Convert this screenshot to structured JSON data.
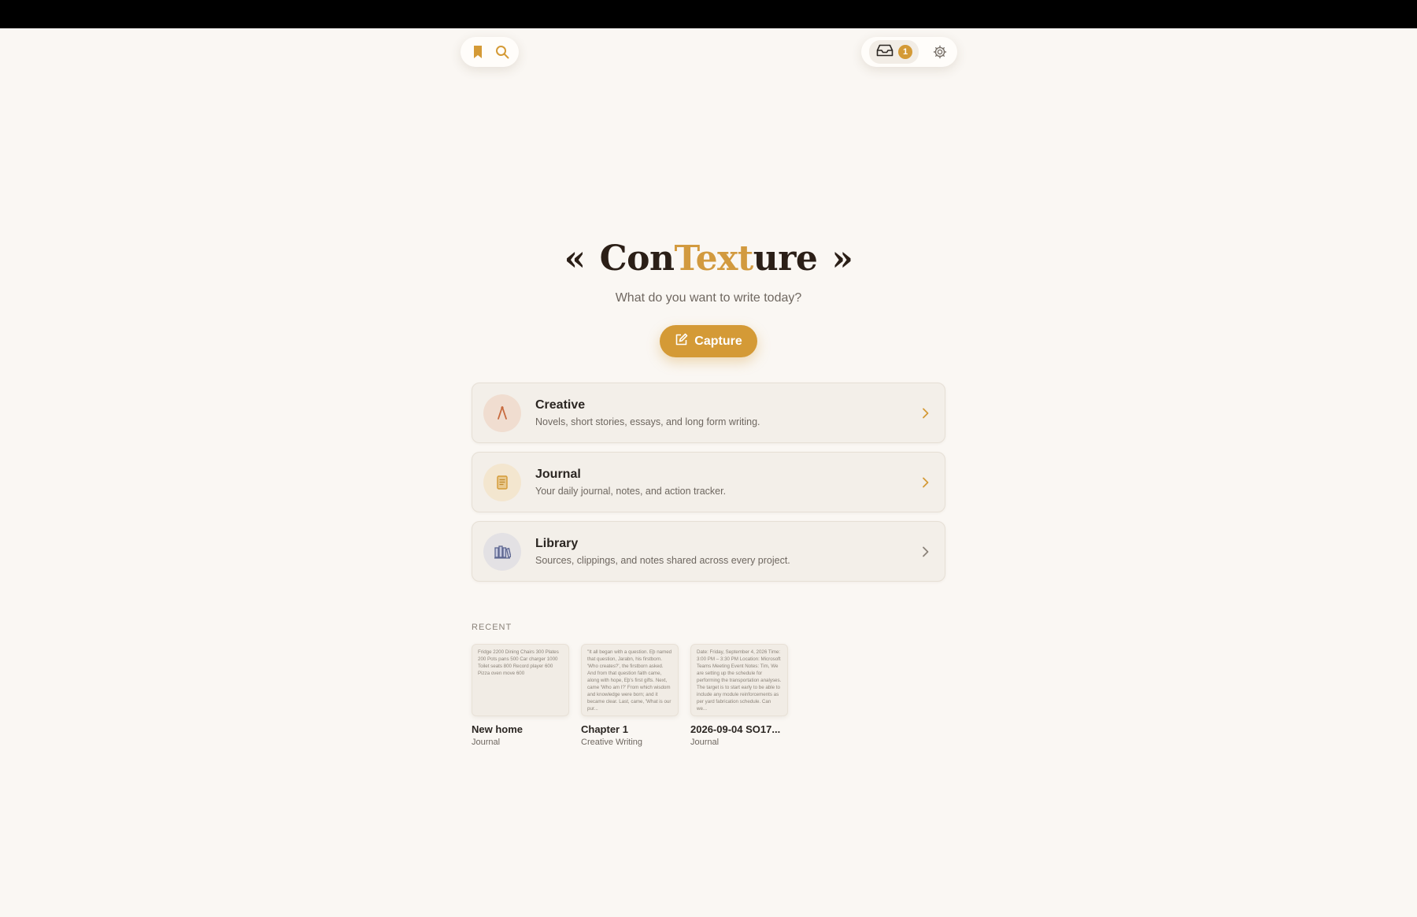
{
  "header": {
    "notification_count": "1",
    "icons": [
      "bookmark-icon",
      "search-icon",
      "inbox-icon",
      "gear-icon"
    ]
  },
  "brand": {
    "quote_left": "«",
    "name_part1": "Con",
    "name_part2": "Text",
    "name_part3": "ure",
    "quote_right": "»",
    "subtitle": "What do you want to write today?"
  },
  "capture": {
    "label": "Capture"
  },
  "sections": [
    {
      "title": "Creative",
      "description": "Novels, short stories, essays, and long form writing.",
      "icon": "pen-nib-icon"
    },
    {
      "title": "Journal",
      "description": "Your daily journal, notes, and action tracker.",
      "icon": "notebook-icon"
    },
    {
      "title": "Library",
      "description": "Sources, clippings, and notes shared across every project.",
      "icon": "books-icon"
    }
  ],
  "recent": {
    "label": "RECENT",
    "items": [
      {
        "preview": "Fridge 2200 Dining Chairs 300 Plates 200 Pots pans 500 Car charger 1000 Toilet seats 800 Record player 600 Pizza oven move 600",
        "title": "New home",
        "category": "Journal"
      },
      {
        "preview": "\"It all began with a question. Eþ named that question, Jarabn, his firstborn. 'Who creates?', the firstborn asked. And from that question faith came, along with hope, Eþ's first gifts. Next, came 'Who am I?' From which wisdom and knowledge were born; and it became clear. Last, came, 'What is our pur...",
        "title": "Chapter 1",
        "category": "Creative Writing"
      },
      {
        "preview": "Date: Friday, September 4, 2026 Time: 3:00 PM – 3:30 PM Location: Microsoft Teams Meeting Event Notes: Tim, We are setting up the schedule for performing the transportation analyses. The target is to start early to be able to include any module reinforcements as per yard fabrication schedule. Can we...",
        "title": "2026-09-04 SO17...",
        "category": "Journal"
      }
    ]
  },
  "colors": {
    "accent": "#d49a36",
    "background": "#faf7f3",
    "card": "#f3efe9"
  }
}
